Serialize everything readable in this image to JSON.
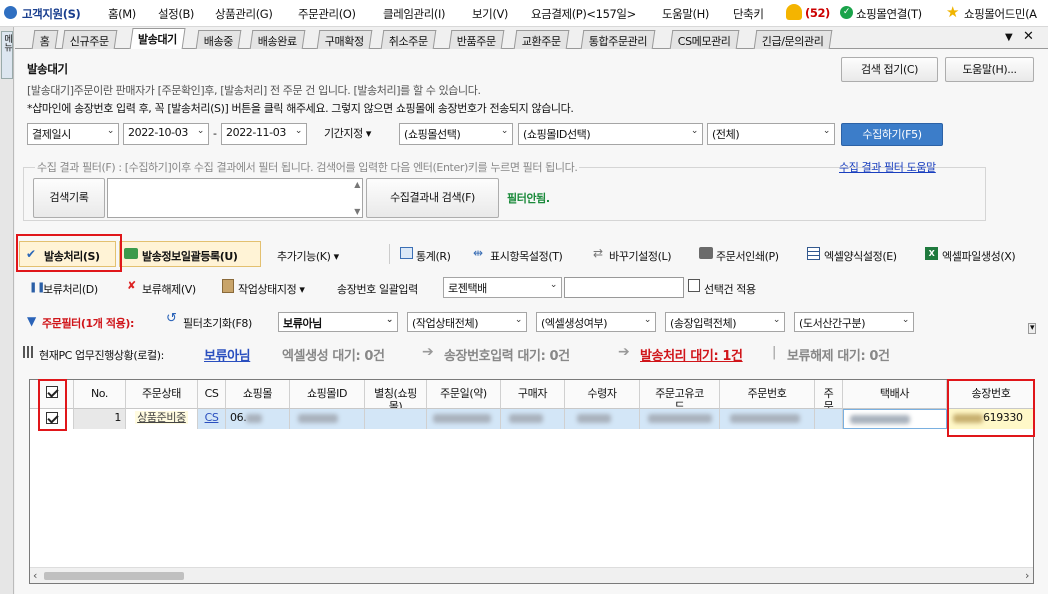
{
  "menu": {
    "support": "고객지원(S)",
    "items": [
      "홈(M)",
      "설정(B)",
      "상품관리(G)",
      "주문관리(O)",
      "클레임관리(I)",
      "보기(V)",
      "요금결제(P)<157일>",
      "도움말(H)",
      "단축키"
    ],
    "notif_count": "(52)",
    "connect": "쇼핑몰연결(T)",
    "addon": "쇼핑몰어드민(A"
  },
  "side": {
    "menu_label": "메뉴"
  },
  "tabs": [
    "홈",
    "신규주문",
    "발송대기",
    "배송중",
    "배송완료",
    "구매확정",
    "취소주문",
    "반품주문",
    "교환주문",
    "통합주문관리",
    "CS메모관리",
    "긴급/문의관리"
  ],
  "page": {
    "title": "발송대기",
    "desc1": "[발송대기]주문이란 판매자가 [주문확인]후, [발송처리] 전 주문 건 입니다. [발송처리]를 할 수 있습니다.",
    "desc2": "*샵마인에 송장번호 입력 후, 꼭 [발송처리(S)] 버튼을 클릭 해주세요. 그렇지 않으면 쇼핑몰에 송장번호가 전송되지 않습니다.",
    "collapse": "검색 접기(C)",
    "help": "도움말(H)..."
  },
  "search": {
    "date_type": "결제일시",
    "date_from": "2022-10-03",
    "date_to": "2022-11-03",
    "dash": "-",
    "period": "기간지정",
    "mall": "(쇼핑몰선택)",
    "mall_id": "(쇼핑몰ID선택)",
    "all": "(전체)",
    "collect": "수집하기(F5)"
  },
  "filter": {
    "hint": "수집 결과 필터(F) : [수집하기]이후 수집 결과에서 필터 됩니다. 검색어를 입력한 다음 엔터(Enter)키를 누르면 필터 됩니다.",
    "help_link": "수집 결과 필터 도움말",
    "history": "검색기록",
    "search_in": "수집결과내 검색(F)",
    "status": "필터안됨."
  },
  "toolbar1": {
    "ship": "발송처리(S)",
    "bulk": "발송정보일괄등록(U)",
    "more": "추가기능(K)",
    "stats": "통계(R)",
    "display": "표시항목설정(T)",
    "shortcut": "바꾸기설정(L)",
    "print": "주문서인쇄(P)",
    "excel_fmt": "엑셀양식설정(E)",
    "excel_gen": "엑셀파일생성(X)"
  },
  "toolbar2": {
    "hold": "보류처리(D)",
    "unhold": "보류해제(V)",
    "work": "작업상태지정",
    "invoice_label": "송장번호 일괄입력",
    "courier": "로젠택배",
    "apply": "선택건 적용"
  },
  "toolbar3": {
    "filter": "주문필터(1개 적용):",
    "reset": "필터초기화(F8)",
    "f1": "보류아님",
    "f2": "(작업상태전체)",
    "f3": "(엑셀생성여부)",
    "f4": "(송장입력전체)",
    "f5": "(도서산간구분)"
  },
  "progress": {
    "label": "현재PC 업무진행상황(로컬):",
    "s1": "보류아님",
    "s2": "엑셀생성 대기: 0건",
    "s3": "송장번호입력 대기: 0건",
    "s4": "발송처리 대기: 1건",
    "s5": "보류해제 대기: 0건"
  },
  "grid": {
    "headers": [
      "No.",
      "주문상태",
      "CS",
      "쇼핑몰",
      "쇼핑몰ID",
      "별칭(쇼핑몰)",
      "주문일(약)",
      "구매자",
      "수령자",
      "주문고유코드",
      "주문번호",
      "주문",
      "택배사",
      "송장번호"
    ],
    "row": {
      "no": "1",
      "status": "상품준비중",
      "cs": "CS",
      "mall": "06.",
      "invoice": "619330"
    }
  }
}
